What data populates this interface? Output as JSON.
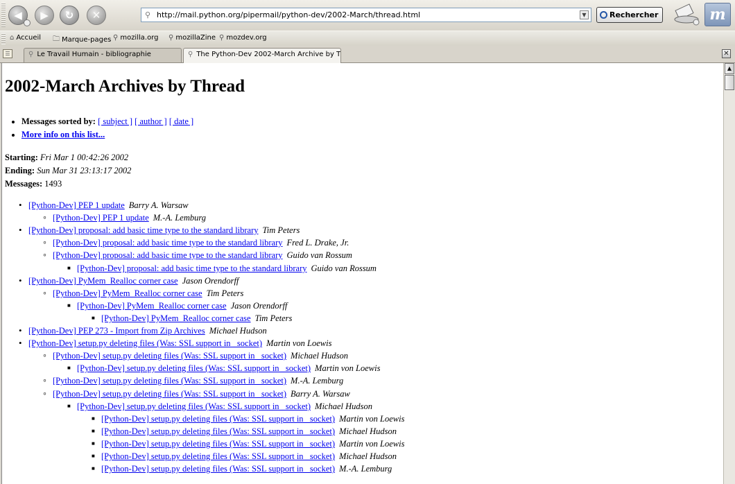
{
  "browser": {
    "url": "http://mail.python.org/pipermail/python-dev/2002-March/thread.html",
    "search_button": "Rechercher",
    "bookmarks": [
      {
        "label": "Accueil",
        "icon": "home-icon"
      },
      {
        "label": "Marque-pages",
        "icon": "folder-icon"
      },
      {
        "label": "mozilla.org",
        "icon": "bookmark-icon"
      },
      {
        "label": "mozillaZine",
        "icon": "bookmark-icon"
      },
      {
        "label": "mozdev.org",
        "icon": "bookmark-icon"
      }
    ],
    "tabs": [
      {
        "label": "Le Travail Humain - bibliographie",
        "active": false
      },
      {
        "label": "The Python-Dev 2002-March Archive by Th...",
        "active": true
      }
    ]
  },
  "page": {
    "title": "2002-March Archives by Thread",
    "sorted_label": "Messages sorted by:",
    "sort_links": [
      "[ subject ]",
      "[ author ]",
      "[ date ]"
    ],
    "more_info": "More info on this list...",
    "starting_label": "Starting:",
    "starting_value": "Fri Mar 1 00:42:26 2002",
    "ending_label": "Ending:",
    "ending_value": "Sun Mar 31 23:13:17 2002",
    "messages_label": "Messages:",
    "messages_value": "1493"
  },
  "threads": [
    {
      "level": 0,
      "subject": "[Python-Dev] PEP 1 update",
      "author": "Barry A. Warsaw"
    },
    {
      "level": 1,
      "subject": "[Python-Dev] PEP 1 update",
      "author": "M.-A. Lemburg"
    },
    {
      "level": 0,
      "subject": "[Python-Dev] proposal: add basic time type to the standard library",
      "author": "Tim Peters"
    },
    {
      "level": 1,
      "subject": "[Python-Dev] proposal: add basic time type to the standard library",
      "author": "Fred L. Drake, Jr."
    },
    {
      "level": 1,
      "subject": "[Python-Dev] proposal: add basic time type to the standard library",
      "author": "Guido van Rossum"
    },
    {
      "level": 2,
      "subject": "[Python-Dev] proposal: add basic time type to the standard library",
      "author": "Guido van Rossum"
    },
    {
      "level": 0,
      "subject": "[Python-Dev] PyMem_Realloc corner case",
      "author": "Jason Orendorff"
    },
    {
      "level": 1,
      "subject": "[Python-Dev] PyMem_Realloc corner case",
      "author": "Tim Peters"
    },
    {
      "level": 2,
      "subject": "[Python-Dev] PyMem_Realloc corner case",
      "author": "Jason Orendorff"
    },
    {
      "level": 3,
      "subject": "[Python-Dev] PyMem_Realloc corner case",
      "author": "Tim Peters"
    },
    {
      "level": 0,
      "subject": "[Python-Dev] PEP 273 - Import from Zip Archives",
      "author": "Michael Hudson"
    },
    {
      "level": 0,
      "subject": "[Python-Dev] setup.py deleting files (Was: SSL support in _socket)",
      "author": "Martin von Loewis"
    },
    {
      "level": 1,
      "subject": "[Python-Dev] setup.py deleting files (Was: SSL support in _socket)",
      "author": "Michael Hudson"
    },
    {
      "level": 2,
      "subject": "[Python-Dev] setup.py deleting files (Was: SSL support in _socket)",
      "author": "Martin von Loewis"
    },
    {
      "level": 1,
      "subject": "[Python-Dev] setup.py deleting files (Was: SSL support in _socket)",
      "author": "M.-A. Lemburg"
    },
    {
      "level": 1,
      "subject": "[Python-Dev] setup.py deleting files (Was: SSL support in _socket)",
      "author": "Barry A. Warsaw"
    },
    {
      "level": 2,
      "subject": "[Python-Dev] setup.py deleting files (Was: SSL support in _socket)",
      "author": "Michael Hudson"
    },
    {
      "level": 3,
      "subject": "[Python-Dev] setup.py deleting files (Was: SSL support in _socket)",
      "author": "Martin von Loewis"
    },
    {
      "level": 3,
      "subject": "[Python-Dev] setup.py deleting files (Was: SSL support in _socket)",
      "author": "Michael Hudson"
    },
    {
      "level": 3,
      "subject": "[Python-Dev] setup.py deleting files (Was: SSL support in _socket)",
      "author": "Martin von Loewis"
    },
    {
      "level": 3,
      "subject": "[Python-Dev] setup.py deleting files (Was: SSL support in _socket)",
      "author": "Michael Hudson"
    },
    {
      "level": 3,
      "subject": "[Python-Dev] setup.py deleting files (Was: SSL support in _socket)",
      "author": "M.-A. Lemburg"
    }
  ]
}
